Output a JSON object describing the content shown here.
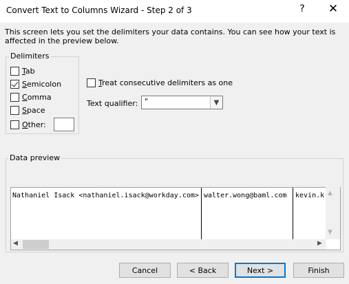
{
  "window": {
    "title": "Convert Text to Columns Wizard - Step 2 of 3",
    "help_label": "?",
    "close_label": "✕"
  },
  "description": "This screen lets you set the delimiters your data contains.  You can see how your text is affected in the preview below.",
  "delimiters": {
    "title": "Delimiters",
    "tab": {
      "label": "Tab",
      "checked": false
    },
    "semicolon": {
      "label": "Semicolon",
      "checked": true
    },
    "comma": {
      "label": "Comma",
      "checked": false
    },
    "space": {
      "label": "Space",
      "checked": false
    },
    "other": {
      "label": "Other:",
      "checked": false,
      "value": ""
    }
  },
  "consecutive": {
    "label": "Treat consecutive delimiters as one",
    "checked": false
  },
  "qualifier": {
    "label": "Text qualifier:",
    "value": "\""
  },
  "preview": {
    "title": "Data preview",
    "columns": [
      "Nathaniel Isack <nathaniel.isack@workday.com>",
      "walter.wong@baml.com",
      "kevin.k"
    ]
  },
  "buttons": {
    "cancel": "Cancel",
    "back": "< Back",
    "next": "Next >",
    "finish": "Finish"
  },
  "colors": {
    "focus_border": "#0078d7",
    "title_bg": "#ffffff",
    "dialog_bg": "#f0f0f0"
  }
}
